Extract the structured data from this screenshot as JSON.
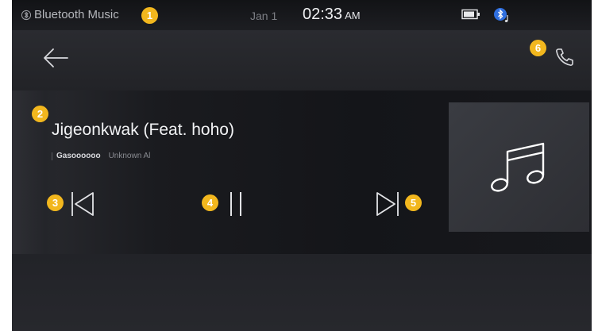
{
  "status_bar": {
    "source": "Bluetooth Music",
    "date": "Jan 1",
    "time": "02:33",
    "ampm": "AM",
    "icons": [
      "bluetooth-icon",
      "battery-icon",
      "bluetooth-audio-icon"
    ]
  },
  "nav": {
    "back_icon": "back-arrow-icon",
    "phone_icon": "phone-icon"
  },
  "track": {
    "title": "Jigeonkwak (Feat. hoho)",
    "artist": "Gasoooooo",
    "album": "Unknown Al"
  },
  "controls": [
    "previous-track-icon",
    "pause-icon",
    "next-track-icon"
  ],
  "album_art_icon": "music-note-icon",
  "badges": [
    "1",
    "2",
    "3",
    "4",
    "5",
    "6"
  ],
  "colors": {
    "badge": "#f2b71e",
    "bluetooth_accent": "#2f6fe0",
    "screen_bg": "#1d1e22"
  }
}
